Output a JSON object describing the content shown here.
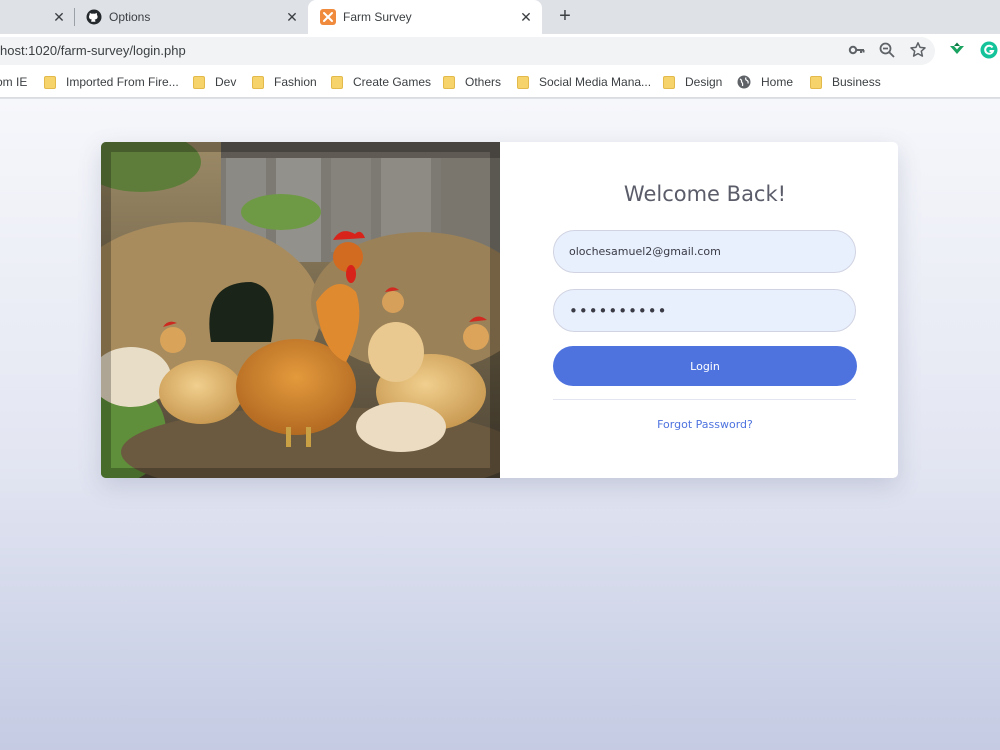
{
  "tabs": [
    {
      "label": "",
      "close_glyph": "✕"
    },
    {
      "label": "Options",
      "icon": "github-icon",
      "close_glyph": "✕"
    },
    {
      "label": "Farm Survey",
      "icon": "xampp-icon",
      "close_glyph": "✕",
      "active": true
    }
  ],
  "new_tab_glyph": "+",
  "address_bar": {
    "url": "host:1020/farm-survey/login.php"
  },
  "bookmarks": [
    {
      "label": "om IE",
      "icon": "none"
    },
    {
      "label": "Imported From Fire...",
      "icon": "folder-icon"
    },
    {
      "label": "Dev",
      "icon": "folder-icon"
    },
    {
      "label": "Fashion",
      "icon": "folder-icon"
    },
    {
      "label": "Create Games",
      "icon": "folder-icon"
    },
    {
      "label": "Others",
      "icon": "folder-icon"
    },
    {
      "label": "Social Media Mana...",
      "icon": "folder-icon"
    },
    {
      "label": "Design",
      "icon": "folder-icon"
    },
    {
      "label": "Home",
      "icon": "globe-icon"
    },
    {
      "label": "Business",
      "icon": "folder-icon"
    }
  ],
  "login": {
    "heading": "Welcome Back!",
    "email_value": "olochesamuel2@gmail.com",
    "password_value": "••••••••••",
    "button_label": "Login",
    "forgot_link": "Forgot Password?"
  },
  "colors": {
    "primary": "#4e73df",
    "input_bg": "#e8f0fe",
    "page_bg_top": "#f6f7fb",
    "page_bg_bottom": "#c4cbe3",
    "active_tab_icon": "#f08a3c"
  }
}
